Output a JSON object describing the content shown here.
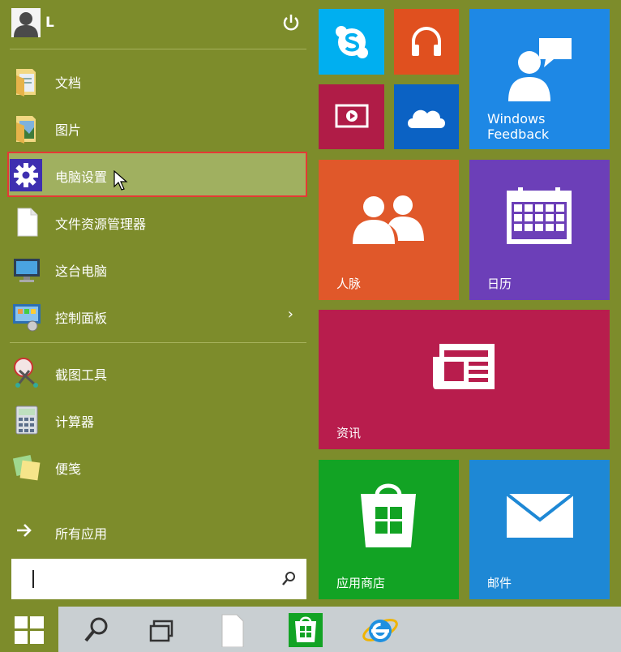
{
  "user": {
    "name": "L"
  },
  "menu": {
    "items": [
      {
        "label": "文档",
        "icon": "documents-folder-icon"
      },
      {
        "label": "图片",
        "icon": "pictures-folder-icon"
      },
      {
        "label": "电脑设置",
        "icon": "settings-gear-icon",
        "selected": true
      },
      {
        "label": "文件资源管理器",
        "icon": "file-explorer-icon"
      },
      {
        "label": "这台电脑",
        "icon": "this-pc-icon"
      },
      {
        "label": "控制面板",
        "icon": "control-panel-icon",
        "has_submenu": true
      },
      {
        "label": "截图工具",
        "icon": "snipping-tool-icon"
      },
      {
        "label": "计算器",
        "icon": "calculator-icon"
      },
      {
        "label": "便笺",
        "icon": "sticky-notes-icon"
      }
    ],
    "all_apps": "所有应用",
    "submenu_chevron": "›"
  },
  "search": {
    "placeholder": ""
  },
  "tiles": {
    "skype": {
      "label": "",
      "color": "#00aff0"
    },
    "music": {
      "label": "",
      "color": "#e0501f"
    },
    "video": {
      "label": "",
      "color": "#b01c47"
    },
    "onedrive": {
      "label": "",
      "color": "#0b62c4"
    },
    "feedback": {
      "label_line1": "Windows",
      "label_line2": "Feedback",
      "color": "#1e88e5"
    },
    "people": {
      "label": "人脉",
      "color": "#e0582a"
    },
    "calendar": {
      "label": "日历",
      "color": "#6c3fb8"
    },
    "news": {
      "label": "资讯",
      "color": "#b81d4d"
    },
    "store": {
      "label": "应用商店",
      "color": "#12a324"
    },
    "mail": {
      "label": "邮件",
      "color": "#1e88d5"
    }
  },
  "taskbar": {
    "items": [
      "start-button",
      "search-icon",
      "task-view-icon",
      "file-icon",
      "store-icon",
      "internet-explorer-icon"
    ]
  }
}
